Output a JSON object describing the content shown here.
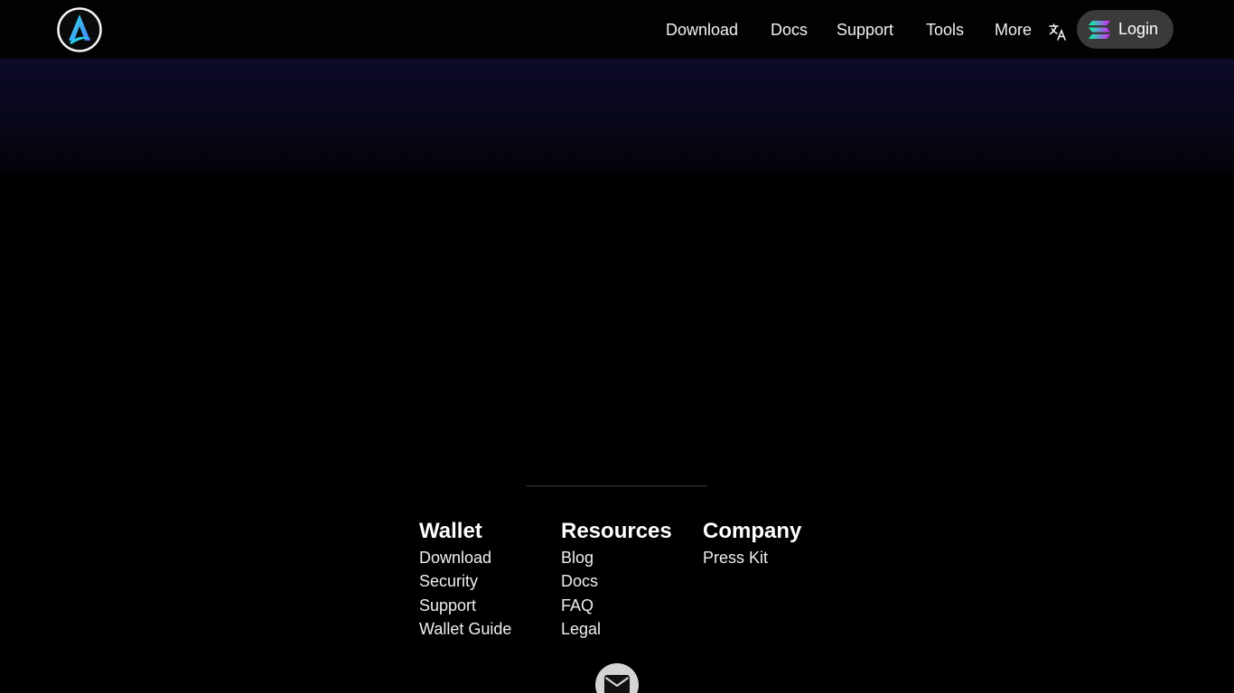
{
  "header": {
    "logo_icon": "app-logo-icon",
    "nav": [
      {
        "label": "Download"
      },
      {
        "label": "Docs"
      },
      {
        "label": "Support"
      },
      {
        "label": "Tools"
      },
      {
        "label": "More"
      }
    ],
    "translate_icon": "translate-icon",
    "login": {
      "label": "Login",
      "icon": "solana-icon"
    }
  },
  "footer": {
    "columns": [
      {
        "heading": "Wallet",
        "links": [
          "Download",
          "Security",
          "Support",
          "Wallet Guide"
        ]
      },
      {
        "heading": "Resources",
        "links": [
          "Blog",
          "Docs",
          "FAQ",
          "Legal"
        ]
      },
      {
        "heading": "Company",
        "links": [
          "Press Kit"
        ]
      }
    ],
    "mail_icon": "mail-icon"
  },
  "colors": {
    "background": "#000000",
    "logo_accent": "#2ee0e6",
    "logo_accent_2": "#4a7bff",
    "login_bg": "#3a3a3c",
    "hero_gradient_top": "#0c0a28"
  }
}
